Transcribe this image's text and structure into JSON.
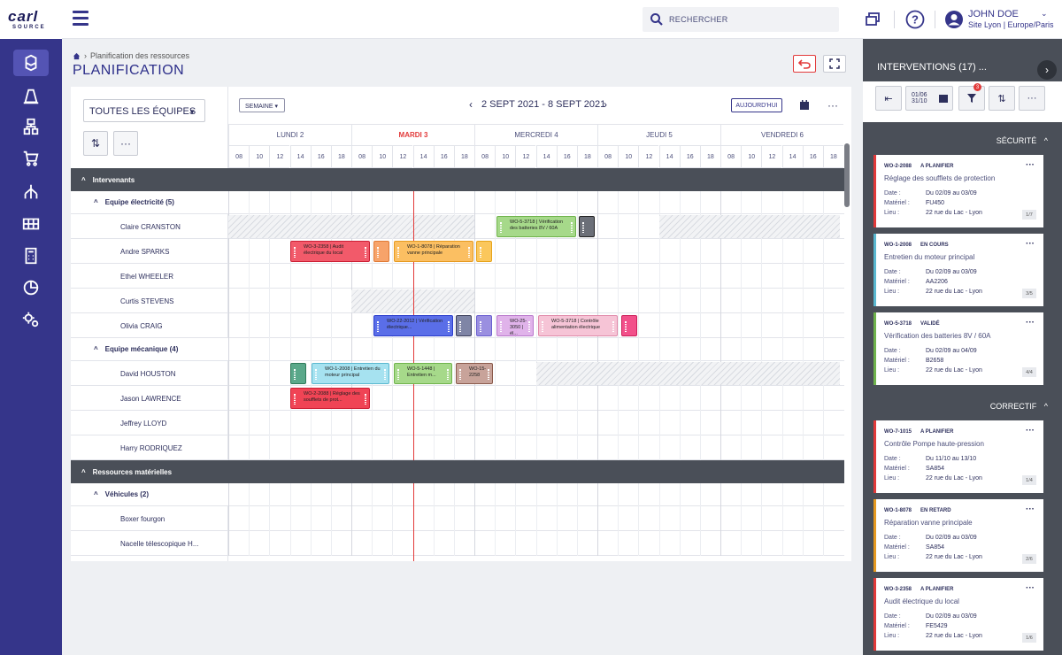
{
  "logo": {
    "line1": "carl",
    "line2": "SOURCE"
  },
  "topbar": {
    "search_placeholder": "RECHERCHER",
    "user_name": "JOHN DOE",
    "user_site": "Site Lyon | Europe/Paris",
    "help_label": "?"
  },
  "header": {
    "breadcrumb": "Planification des ressources",
    "title": "PLANIFICATION"
  },
  "planner": {
    "team_select": "TOUTES LES ÉQUIPES",
    "view_select": "SEMAINE",
    "range": "2 SEPT 2021 - 8 SEPT 2021",
    "today_button": "AUJOURD'HUI",
    "days": [
      {
        "label": "LUNDI 2",
        "today": false
      },
      {
        "label": "MARDI 3",
        "today": true
      },
      {
        "label": "MERCREDI 4",
        "today": false
      },
      {
        "label": "JEUDI 5",
        "today": false
      },
      {
        "label": "VENDREDI 6",
        "today": false
      }
    ],
    "hours": [
      "08",
      "10",
      "12",
      "14",
      "16",
      "18"
    ],
    "rows": [
      {
        "kind": "group",
        "label": "Intervenants"
      },
      {
        "kind": "sub",
        "label": "Equipe électricité (5)"
      },
      {
        "kind": "res",
        "label": "Claire CRANSTON"
      },
      {
        "kind": "res",
        "label": "Andre SPARKS"
      },
      {
        "kind": "res",
        "label": "Ethel WHEELER"
      },
      {
        "kind": "res",
        "label": "Curtis STEVENS"
      },
      {
        "kind": "res",
        "label": "Olivia CRAIG"
      },
      {
        "kind": "sub",
        "label": "Equipe mécanique (4)"
      },
      {
        "kind": "res",
        "label": "David HOUSTON"
      },
      {
        "kind": "res",
        "label": "Jason LAWRENCE"
      },
      {
        "kind": "res",
        "label": "Jeffrey LLOYD"
      },
      {
        "kind": "res",
        "label": "Harry RODRIQUEZ"
      },
      {
        "kind": "group",
        "label": "Ressources matérielles"
      },
      {
        "kind": "sub",
        "label": "Véhicules (2)"
      },
      {
        "kind": "res",
        "label": "Boxer fourgon"
      },
      {
        "kind": "res",
        "label": "Nacelle télescopique H..."
      }
    ],
    "tasks": [
      {
        "row": 2,
        "text": "WO-5-3718 | Vérification des batteries 8V / 60A",
        "color": "#a6d98a",
        "border": "#6fb34c"
      },
      {
        "row": 2,
        "text": "",
        "color": "#6b6f78",
        "border": "#222222"
      },
      {
        "row": 3,
        "text": "WO-3-2358 | Audit électrique du local",
        "color": "#f25a6a",
        "border": "#cc1f35"
      },
      {
        "row": 3,
        "text": "",
        "color": "#f7a36a",
        "border": "#e07a36"
      },
      {
        "row": 3,
        "text": "WO-1-8078 | Réparation vanne principale",
        "color": "#fbbf62",
        "border": "#e69a20"
      },
      {
        "row": 3,
        "text": "",
        "color": "#fbc75c",
        "border": "#e6a31a"
      },
      {
        "row": 6,
        "text": "WO-22-2012 | Vérification électrique...",
        "color": "#5a6ee8",
        "border": "#2a3ccc"
      },
      {
        "row": 6,
        "text": "",
        "color": "#7f85a6",
        "border": "#3c3f5c"
      },
      {
        "row": 6,
        "text": "",
        "color": "#9a8fe0",
        "border": "#6a5ed0"
      },
      {
        "row": 6,
        "text": "WO-25-3050 | él...",
        "color": "#e0b3ea",
        "border": "#b978cc"
      },
      {
        "row": 6,
        "text": "WO-5-3718 | Contrôle alimentation électrique",
        "color": "#f6c4d6",
        "border": "#e08aaa"
      },
      {
        "row": 6,
        "text": "",
        "color": "#f2508a",
        "border": "#cc1f5a"
      },
      {
        "row": 8,
        "text": "",
        "color": "#5aa88a",
        "border": "#2f7a5a"
      },
      {
        "row": 8,
        "text": "WO-1-2008 | Entretien du moteur principal",
        "color": "#a6e2f0",
        "border": "#5ab8d0"
      },
      {
        "row": 8,
        "text": "WO-5-1448 | Entretien m...",
        "color": "#a6d98a",
        "border": "#6fb34c"
      },
      {
        "row": 8,
        "text": "WO-15-2258",
        "color": "#c8a39a",
        "border": "#8a5a4c"
      },
      {
        "row": 9,
        "text": "WO-2-2088 | Réglage des soufflets de prot...",
        "color": "#f04455",
        "border": "#cc1f35"
      }
    ]
  },
  "rpanel": {
    "title": "INTERVENTIONS (17) ...",
    "date_from": "01/06",
    "date_to": "31/10",
    "filter_count": "3",
    "sections": [
      {
        "label": "SÉCURITÉ"
      },
      {
        "label": "CORRECTIF"
      }
    ],
    "field_labels": {
      "date": "Date :",
      "materiel": "Matériel :",
      "lieu": "Lieu :"
    },
    "cards": [
      {
        "id": "WO-2-2088",
        "status": "A PLANIFIER",
        "title": "Réglage des soufflets de protection",
        "date": "Du 02/09 au 03/09",
        "materiel": "FU450",
        "lieu": "22 rue du Lac - Lyon",
        "page": "1/7",
        "color": "#e23a3a"
      },
      {
        "id": "WO-1-2008",
        "status": "EN COURS",
        "title": "Entretien du moteur principal",
        "date": "Du 02/09 au 03/09",
        "materiel": "AA2206",
        "lieu": "22 rue du Lac - Lyon",
        "page": "3/5",
        "color": "#5ab8d0"
      },
      {
        "id": "WO-5-3718",
        "status": "VALIDÉ",
        "title": "Vérification des batteries 8V / 60A",
        "date": "Du 02/09 au 04/09",
        "materiel": "B2658",
        "lieu": "22 rue du Lac - Lyon",
        "page": "4/4",
        "color": "#6fb34c"
      },
      {
        "id": "WO-7-1015",
        "status": "A PLANIFIER",
        "title": "Contrôle Pompe haute-pression",
        "date": "Du 11/10 au 13/10",
        "materiel": "SA854",
        "lieu": "22 rue du Lac - Lyon",
        "page": "1/4",
        "color": "#e23a3a"
      },
      {
        "id": "WO-1-8078",
        "status": "EN RETARD",
        "title": "Réparation vanne principale",
        "date": "Du 02/09 au 03/09",
        "materiel": "SA854",
        "lieu": "22 rue du Lac - Lyon",
        "page": "2/6",
        "color": "#e69a20"
      },
      {
        "id": "WO-3-2358",
        "status": "A PLANIFIER",
        "title": "Audit électrique du local",
        "date": "Du 02/09 au 03/09",
        "materiel": "FE5429",
        "lieu": "22 rue du Lac - Lyon",
        "page": "1/6",
        "color": "#e23a3a"
      }
    ]
  }
}
